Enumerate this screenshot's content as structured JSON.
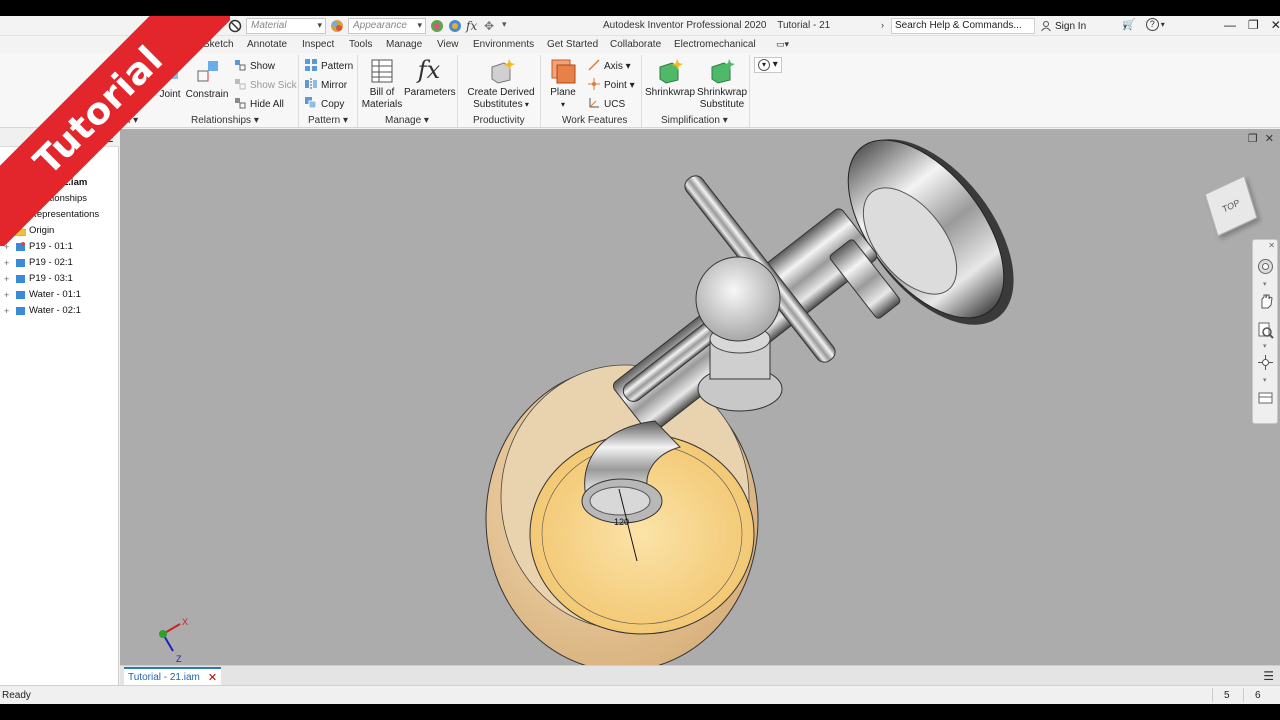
{
  "titlebar": {
    "material_placeholder": "Material",
    "appearance_placeholder": "Appearance",
    "app_name": "Autodesk Inventor Professional 2020",
    "document": "Tutorial - 21",
    "search_placeholder": "Search Help & Commands...",
    "sign_in": "Sign In",
    "help": "?"
  },
  "tabs": [
    "Sketch",
    "Annotate",
    "Inspect",
    "Tools",
    "Manage",
    "View",
    "Environments",
    "Get Started",
    "Collaborate",
    "Electromechanical"
  ],
  "ribbon": {
    "position": {
      "joint": "Joint",
      "constrain": "Constrain",
      "show": "Show",
      "show_sick": "Show Sick",
      "hide_all": "Hide All",
      "panel_left": "ion",
      "panel_relationships": "Relationships"
    },
    "pattern": {
      "pattern": "Pattern",
      "mirror": "Mirror",
      "copy": "Copy",
      "panel": "Pattern"
    },
    "manage": {
      "bom_line1": "Bill of",
      "bom_line2": "Materials",
      "parameters": "Parameters",
      "panel": "Manage"
    },
    "productivity": {
      "derived_line1": "Create Derived",
      "derived_line2": "Substitutes",
      "panel": "Productivity"
    },
    "work_features": {
      "plane": "Plane",
      "axis": "Axis",
      "point": "Point",
      "ucs": "UCS",
      "panel": "Work Features"
    },
    "simplification": {
      "shrinkwrap": "Shrinkwrap",
      "shrinkwrap_sub_line1": "Shrinkwrap",
      "shrinkwrap_sub_line2": "Substitute",
      "panel": "Simplification"
    }
  },
  "browser": {
    "modeling": "eling",
    "root": "1 - 21.iam",
    "items": [
      {
        "label": "Relationships",
        "icon": "relationships-icon"
      },
      {
        "label": "Representations",
        "icon": "representations-icon"
      },
      {
        "label": "Origin",
        "icon": "folder-icon"
      },
      {
        "label": "P19 - 01:1",
        "icon": "part-grounded-icon"
      },
      {
        "label": "P19 - 02:1",
        "icon": "part-icon"
      },
      {
        "label": "P19 - 03:1",
        "icon": "part-icon"
      },
      {
        "label": "Water - 01:1",
        "icon": "part-icon"
      },
      {
        "label": "Water - 02:1",
        "icon": "part-icon"
      }
    ]
  },
  "viewport": {
    "viewcube": "TOP",
    "dimension": "120",
    "axis_x": "X",
    "axis_z": "Z"
  },
  "doc_tab": "Tutorial - 21.iam",
  "status": {
    "text": "Ready",
    "num1": "5",
    "num2": "6"
  },
  "banner": "Tutorial",
  "colors": {
    "banner": "#e3262b",
    "viewport_bg": "#acacac",
    "liquid": "#f6d48a",
    "cup": "#e8c89a"
  }
}
